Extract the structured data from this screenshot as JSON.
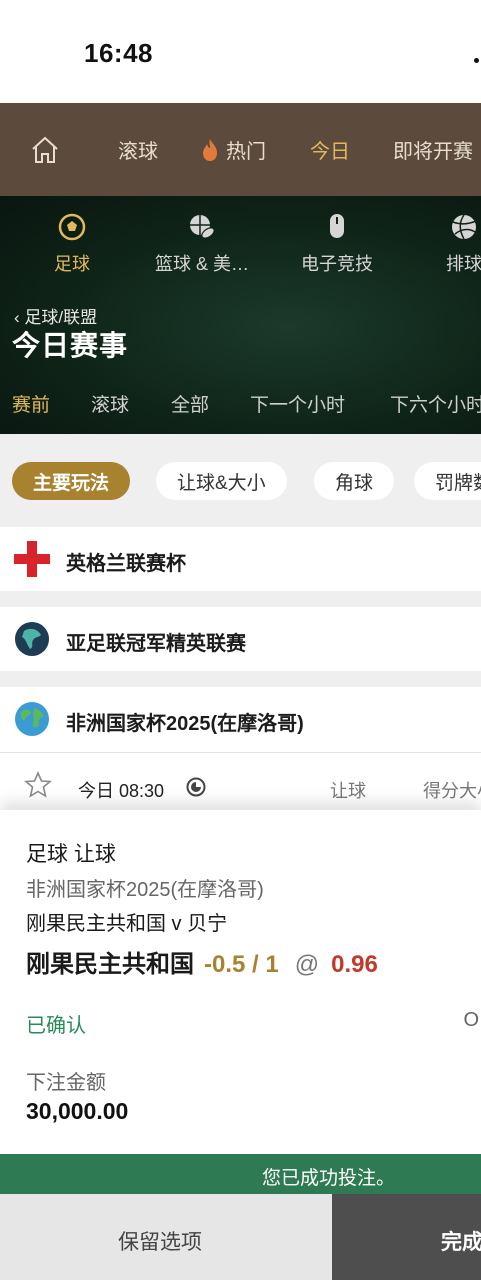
{
  "status_bar": {
    "time": "16:48"
  },
  "top_nav": {
    "items": [
      {
        "label": "滚球"
      },
      {
        "label": "热门"
      },
      {
        "label": "今日"
      },
      {
        "label": "即将开赛"
      }
    ],
    "active_index": 2
  },
  "sports": {
    "items": [
      {
        "label": "足球",
        "icon": "soccer-ball-icon"
      },
      {
        "label": "篮球 & 美…",
        "icon": "basketball-icon"
      },
      {
        "label": "电子竞技",
        "icon": "esports-mouse-icon"
      },
      {
        "label": "排球",
        "icon": "volleyball-icon"
      }
    ],
    "active_index": 0
  },
  "breadcrumb": {
    "label": "足球/联盟"
  },
  "page_title": "今日赛事",
  "sub_tabs": [
    {
      "label": "赛前"
    },
    {
      "label": "滚球"
    },
    {
      "label": "全部"
    },
    {
      "label": "下一个小时"
    },
    {
      "label": "下六个小时"
    }
  ],
  "filters": [
    {
      "label": "主要玩法"
    },
    {
      "label": "让球&大小"
    },
    {
      "label": "角球"
    },
    {
      "label": "罚牌数"
    }
  ],
  "leagues": [
    {
      "name": "英格兰联赛杯",
      "flag": "england-flag-icon"
    },
    {
      "name": "亚足联冠军精英联赛",
      "flag": "asia-globe-icon"
    },
    {
      "name": "非洲国家杯2025(在摩洛哥)",
      "flag": "world-globe-icon"
    }
  ],
  "match": {
    "time": "今日 08:30",
    "col_handicap": "让球",
    "col_total": "得分大小"
  },
  "bet_slip": {
    "market": "足球 让球",
    "competition": "非洲国家杯2025(在摩洛哥)",
    "fixture": "刚果民主共和国 v 贝宁",
    "selection": "刚果民主共和国",
    "handicap": "-0.5 / 1",
    "at": "@",
    "odds": "0.96",
    "status": "已确认",
    "status_right": "O",
    "stake_label": "下注金额",
    "stake_value": "30,000.00"
  },
  "success_message": "您已成功投注。",
  "buttons": {
    "keep_selection": "保留选项",
    "done": "完成"
  },
  "colors": {
    "accent_gold": "#a8822f",
    "nav_brown": "#5c4a3c",
    "success_green": "#2e7a52",
    "odds_red": "#c0392b"
  }
}
